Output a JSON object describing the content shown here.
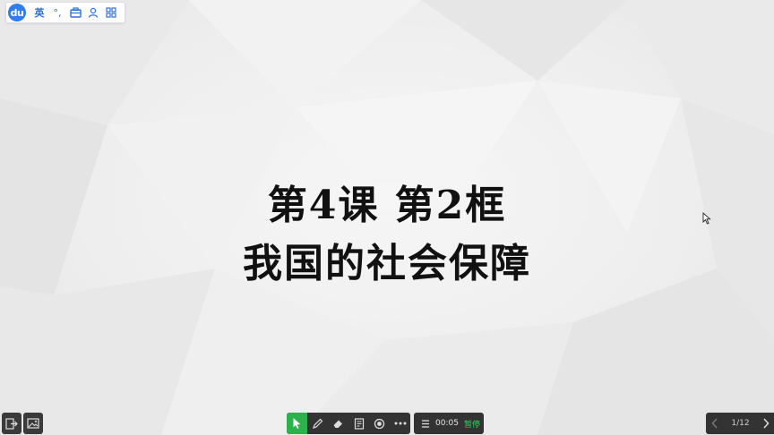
{
  "ime_toolbar": {
    "logo_text": "du",
    "language": "英",
    "punct": "°,",
    "icons": [
      "toolbox-icon",
      "user-icon",
      "grid-icon"
    ]
  },
  "slide": {
    "title_line1": "第4课 第2框",
    "title_line2": "我国的社会保障"
  },
  "toolbar": {
    "tools": [
      "pointer-icon",
      "pen-icon",
      "eraser-icon",
      "note-icon",
      "record-icon",
      "more-icon"
    ],
    "active_tool": "pointer-icon",
    "timer": "00:05",
    "pause_label": "暂停"
  },
  "pager": {
    "page_indicator": "1/12"
  },
  "colors": {
    "accent_green": "#2bb24c",
    "toolbar_bg": "#333333",
    "ime_blue": "#2f7ef0"
  }
}
